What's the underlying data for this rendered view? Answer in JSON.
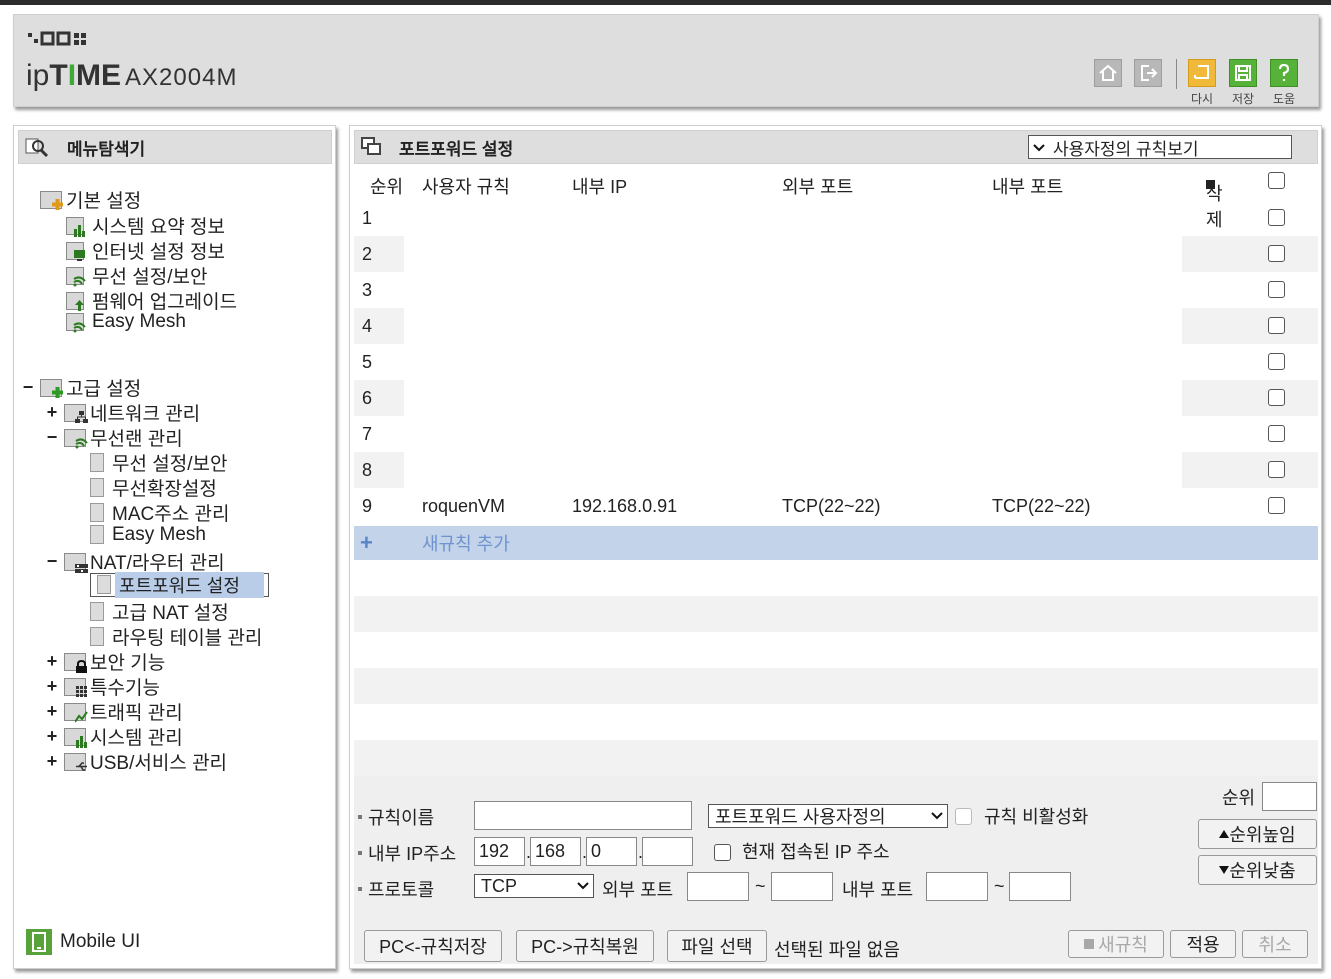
{
  "brand": {
    "logo_dots": "▪▫▢▢▪▪",
    "logo_ip": "ip",
    "logo_time": "TIME",
    "model": "AX2004M"
  },
  "header_buttons": [
    {
      "icon": "home-icon",
      "label": ""
    },
    {
      "icon": "logout-icon",
      "label": ""
    },
    {
      "icon": "redo-icon",
      "label": "다시"
    },
    {
      "icon": "save-icon",
      "label": "저장"
    },
    {
      "icon": "help-icon",
      "label": "도움"
    }
  ],
  "sidebar": {
    "title": "메뉴탐색기",
    "basic": {
      "label": "기본 설정",
      "items": [
        "시스템 요약 정보",
        "인터넷 설정 정보",
        "무선 설정/보안",
        "펌웨어 업그레이드",
        "Easy Mesh"
      ]
    },
    "advanced": {
      "label": "고급 설정",
      "network": "네트워크 관리",
      "wireless": "무선랜 관리",
      "wireless_items": [
        "무선 설정/보안",
        "무선확장설정",
        "MAC주소 관리",
        "Easy Mesh"
      ],
      "nat": "NAT/라우터 관리",
      "nat_items": [
        "포트포워드 설정",
        "고급 NAT 설정",
        "라우팅 테이블 관리"
      ],
      "security": "보안 기능",
      "special": "특수기능",
      "traffic": "트래픽 관리",
      "system": "시스템 관리",
      "usb": "USB/서비스 관리"
    },
    "mobile_ui": "Mobile UI"
  },
  "main": {
    "title": "포트포워드 설정",
    "view_select": "사용자정의 규칙보기",
    "columns": {
      "order": "순위",
      "rule": "사용자 규칙",
      "internal_ip": "내부 IP",
      "external_port": "외부 포트",
      "internal_port": "내부 포트",
      "delete": "삭제"
    },
    "rows": [
      {
        "n": "1",
        "rule": "",
        "ip": "",
        "ext": "",
        "int": ""
      },
      {
        "n": "2",
        "rule": "",
        "ip": "",
        "ext": "",
        "int": ""
      },
      {
        "n": "3",
        "rule": "",
        "ip": "",
        "ext": "",
        "int": ""
      },
      {
        "n": "4",
        "rule": "",
        "ip": "",
        "ext": "",
        "int": ""
      },
      {
        "n": "5",
        "rule": "",
        "ip": "",
        "ext": "",
        "int": ""
      },
      {
        "n": "6",
        "rule": "",
        "ip": "",
        "ext": "",
        "int": ""
      },
      {
        "n": "7",
        "rule": "",
        "ip": "",
        "ext": "",
        "int": ""
      },
      {
        "n": "8",
        "rule": "",
        "ip": "",
        "ext": "",
        "int": ""
      },
      {
        "n": "9",
        "rule": "roquenVM",
        "ip": "192.168.0.91",
        "ext": "TCP(22~22)",
        "int": "TCP(22~22)"
      }
    ],
    "add_rule": "새규칙 추가"
  },
  "form": {
    "rule_name_label": "규칙이름",
    "rule_name_value": "",
    "rule_type": "포트포워드 사용자정의",
    "disable_label": "규칙 비활성화",
    "ip_label": "내부 IP주소",
    "ip1": "192",
    "ip2": "168",
    "ip3": "0",
    "ip4": "",
    "current_ip_label": "현재 접속된 IP 주소",
    "protocol_label": "프로토콜",
    "protocol": "TCP",
    "ext_port_label": "외부 포트",
    "int_port_label": "내부 포트",
    "tilde": "~",
    "order_label": "순위",
    "order_value": "",
    "order_up": "순위높임",
    "order_down": "순위낮춤"
  },
  "footer": {
    "pc_save": "PC<-규칙저장",
    "pc_restore": "PC->규칙복원",
    "file_select": "파일 선택",
    "no_file": "선택된 파일 없음",
    "new_rule": "새규칙",
    "apply": "적용",
    "cancel": "취소"
  },
  "colors": {
    "accent_green": "#3fa836",
    "selected_row": "#b9cde8",
    "add_row": "#c3d3ea",
    "panel_grey": "#dedede"
  }
}
